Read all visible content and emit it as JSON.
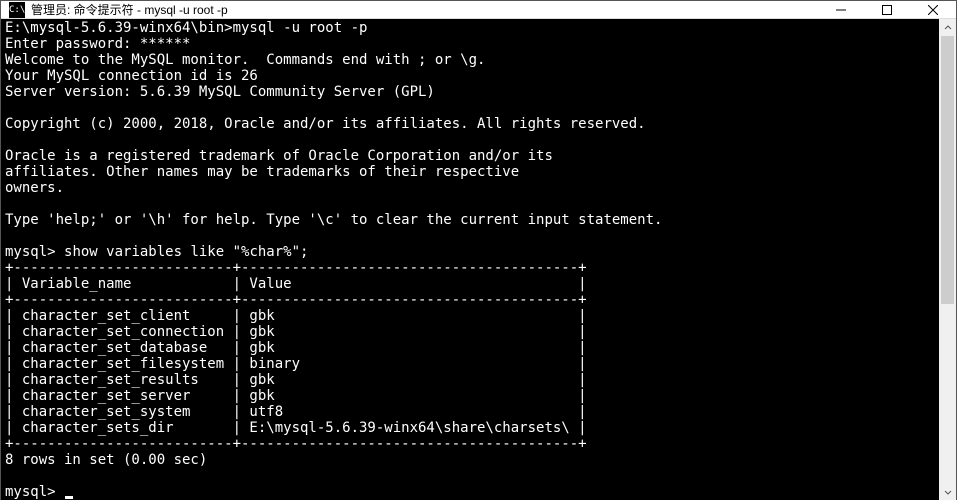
{
  "titlebar": {
    "icon_text": "C:\\",
    "title": "管理员: 命令提示符 - mysql  -u root -p"
  },
  "terminal": {
    "prompt_path": "E:\\mysql-5.6.39-winx64\\bin>",
    "command": "mysql -u root -p",
    "enter_password_label": "Enter password: ",
    "password_mask": "******",
    "welcome_line": "Welcome to the MySQL monitor.  Commands end with ; or \\g.",
    "connection_line": "Your MySQL connection id is 26",
    "server_line": "Server version: 5.6.39 MySQL Community Server (GPL)",
    "copyright_line": "Copyright (c) 2000, 2018, Oracle and/or its affiliates. All rights reserved.",
    "trademark_l1": "Oracle is a registered trademark of Oracle Corporation and/or its",
    "trademark_l2": "affiliates. Other names may be trademarks of their respective",
    "trademark_l3": "owners.",
    "help_line": "Type 'help;' or '\\h' for help. Type '\\c' to clear the current input statement.",
    "mysql_prompt": "mysql> ",
    "query": "show variables like \"%char%\";",
    "table_border_top": "+--------------------------+----------------------------------------+",
    "table_header": "| Variable_name            | Value                                  |",
    "table_border_head": "+--------------------------+----------------------------------------+",
    "row1": "| character_set_client     | gbk                                    |",
    "row2": "| character_set_connection | gbk                                    |",
    "row3": "| character_set_database   | gbk                                    |",
    "row4": "| character_set_filesystem | binary                                 |",
    "row5": "| character_set_results    | gbk                                    |",
    "row6": "| character_set_server     | gbk                                    |",
    "row7": "| character_set_system     | utf8                                   |",
    "row8": "| character_sets_dir       | E:\\mysql-5.6.39-winx64\\share\\charsets\\ |",
    "table_border_bot": "+--------------------------+----------------------------------------+",
    "result_line": "8 rows in set (0.00 sec)"
  }
}
